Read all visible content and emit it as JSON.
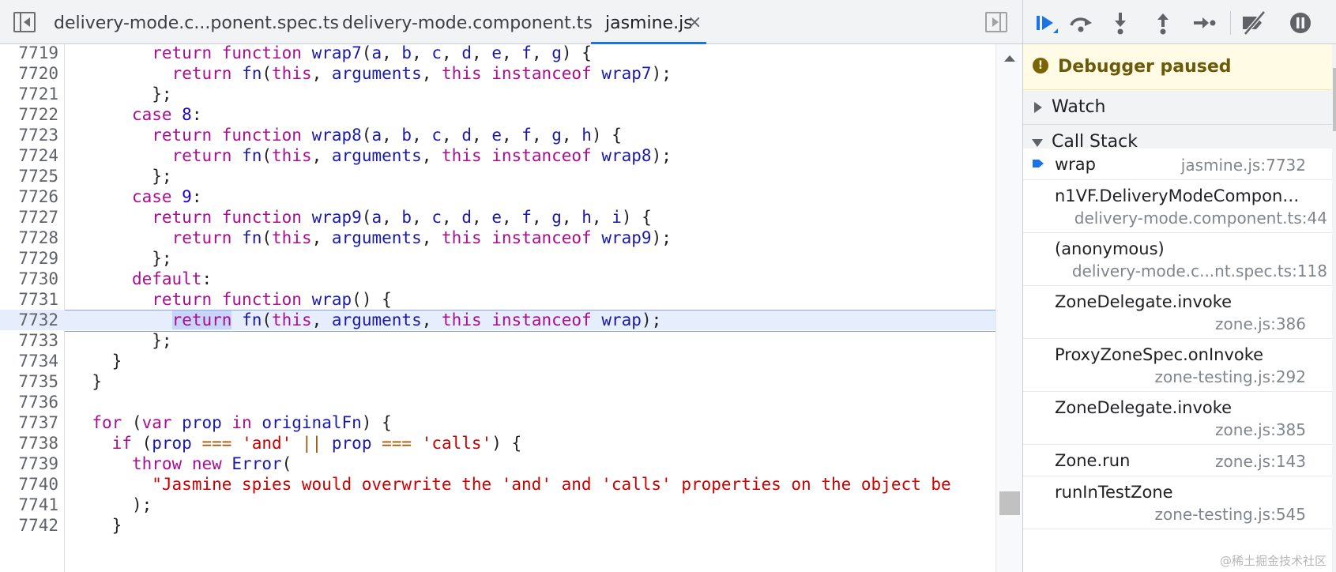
{
  "tabs": [
    {
      "label": "delivery-mode.c...ponent.spec.ts",
      "active": false
    },
    {
      "label": "delivery-mode.component.ts",
      "active": false
    },
    {
      "label": "jasmine.js",
      "active": true
    }
  ],
  "tab_close_glyph": "×",
  "editor": {
    "current_line": "7732",
    "lines": [
      {
        "n": "7719",
        "code": "        return function wrap7(a, b, c, d, e, f, g) {"
      },
      {
        "n": "7720",
        "code": "          return fn(this, arguments, this instanceof wrap7);"
      },
      {
        "n": "7721",
        "code": "        };"
      },
      {
        "n": "7722",
        "code": "      case 8:"
      },
      {
        "n": "7723",
        "code": "        return function wrap8(a, b, c, d, e, f, g, h) {"
      },
      {
        "n": "7724",
        "code": "          return fn(this, arguments, this instanceof wrap8);"
      },
      {
        "n": "7725",
        "code": "        };"
      },
      {
        "n": "7726",
        "code": "      case 9:"
      },
      {
        "n": "7727",
        "code": "        return function wrap9(a, b, c, d, e, f, g, h, i) {"
      },
      {
        "n": "7728",
        "code": "          return fn(this, arguments, this instanceof wrap9);"
      },
      {
        "n": "7729",
        "code": "        };"
      },
      {
        "n": "7730",
        "code": "      default:"
      },
      {
        "n": "7731",
        "code": "        return function wrap() {"
      },
      {
        "n": "7732",
        "code": "          return fn(this, arguments, this instanceof wrap);"
      },
      {
        "n": "7733",
        "code": "        };"
      },
      {
        "n": "7734",
        "code": "    }"
      },
      {
        "n": "7735",
        "code": "  }"
      },
      {
        "n": "7736",
        "code": ""
      },
      {
        "n": "7737",
        "code": "  for (var prop in originalFn) {"
      },
      {
        "n": "7738",
        "code": "    if (prop === 'and' || prop === 'calls') {"
      },
      {
        "n": "7739",
        "code": "      throw new Error("
      },
      {
        "n": "7740",
        "code": "        \"Jasmine spies would overwrite the 'and' and 'calls' properties on the object be"
      },
      {
        "n": "7741",
        "code": "      );"
      },
      {
        "n": "7742",
        "code": "    }"
      }
    ]
  },
  "debugger": {
    "toolbar_icons": [
      "resume-icon",
      "step-over-icon",
      "step-into-icon",
      "step-out-icon",
      "step-icon",
      "deactivate-breakpoints-icon",
      "pause-on-exceptions-icon"
    ],
    "paused_label": "Debugger paused",
    "watch_label": "Watch",
    "call_stack_label": "Call Stack",
    "frames": [
      {
        "name": "wrap",
        "location": "jasmine.js:7732",
        "current": true
      },
      {
        "name": "n1VF.DeliveryModeCompone...",
        "location": "delivery-mode.component.ts:44"
      },
      {
        "name": "(anonymous)",
        "location": "delivery-mode.c...nt.spec.ts:118"
      },
      {
        "name": "ZoneDelegate.invoke",
        "location": "zone.js:386"
      },
      {
        "name": "ProxyZoneSpec.onInvoke",
        "location": "zone-testing.js:292"
      },
      {
        "name": "ZoneDelegate.invoke",
        "location": "zone.js:385"
      },
      {
        "name": "Zone.run",
        "location": "zone.js:143"
      },
      {
        "name": "runInTestZone",
        "location": "zone-testing.js:545"
      }
    ]
  },
  "watermark": "@稀土掘金技术社区",
  "colors": {
    "accent": "#1a73e8",
    "keyword": "#aa0d91",
    "string": "#c80000",
    "current_line_bg": "#e6edfc",
    "paused_banner_bg": "#fffbe5"
  }
}
